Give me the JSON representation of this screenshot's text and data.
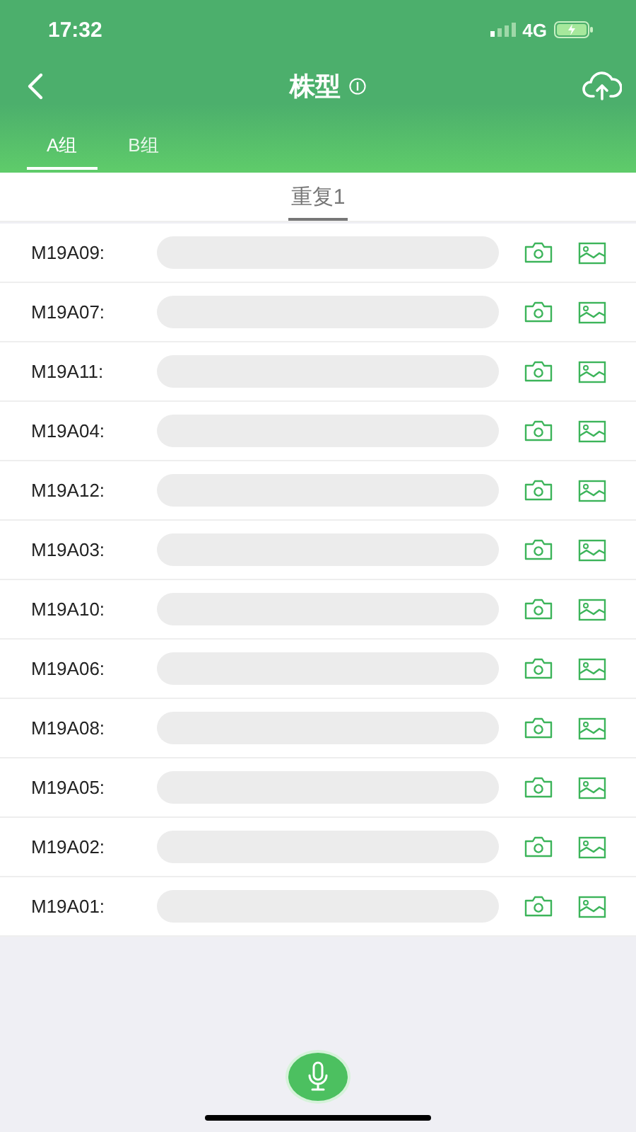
{
  "status_bar": {
    "time": "17:32",
    "network": "4G"
  },
  "nav": {
    "title": "株型"
  },
  "tabs": [
    {
      "label": "A组",
      "selected": true
    },
    {
      "label": "B组",
      "selected": false
    }
  ],
  "subtabs": [
    {
      "label": "重复1",
      "selected": true
    }
  ],
  "rows": [
    {
      "label": "M19A09:"
    },
    {
      "label": "M19A07:"
    },
    {
      "label": "M19A11:"
    },
    {
      "label": "M19A04:"
    },
    {
      "label": "M19A12:"
    },
    {
      "label": "M19A03:"
    },
    {
      "label": "M19A10:"
    },
    {
      "label": "M19A06:"
    },
    {
      "label": "M19A08:"
    },
    {
      "label": "M19A05:"
    },
    {
      "label": "M19A02:"
    },
    {
      "label": "M19A01:"
    }
  ]
}
